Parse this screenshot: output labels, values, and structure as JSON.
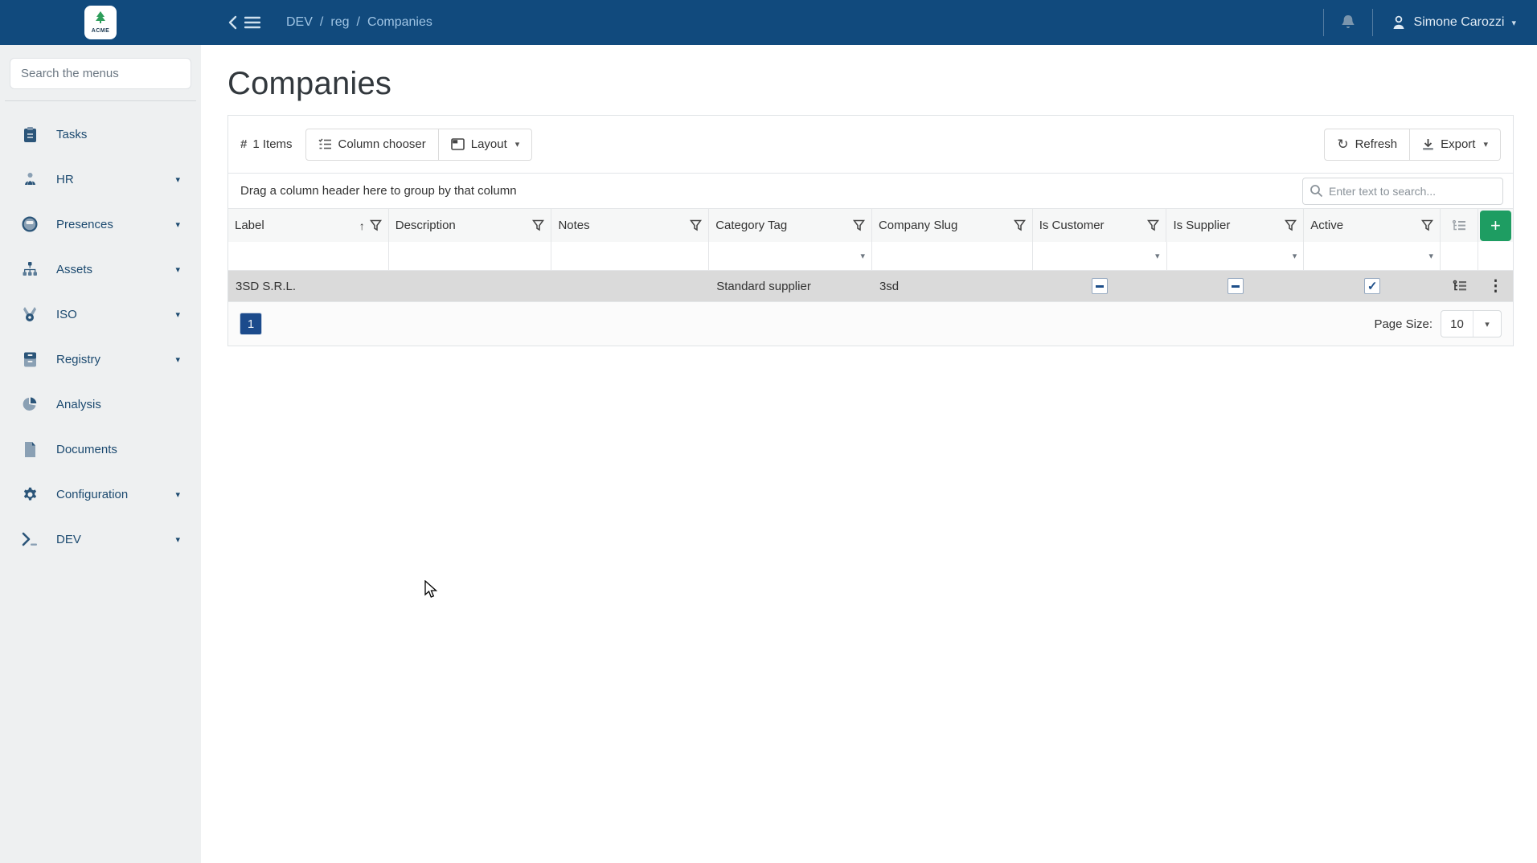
{
  "navbar": {
    "logo_text": "ACME",
    "breadcrumb": {
      "items": [
        "DEV",
        "reg",
        "Companies"
      ]
    },
    "user_name": "Simone Carozzi"
  },
  "sidebar": {
    "search_placeholder": "Search the menus",
    "items": [
      {
        "label": "Tasks"
      },
      {
        "label": "HR"
      },
      {
        "label": "Presences"
      },
      {
        "label": "Assets"
      },
      {
        "label": "ISO"
      },
      {
        "label": "Registry"
      },
      {
        "label": "Analysis"
      },
      {
        "label": "Documents"
      },
      {
        "label": "Configuration"
      },
      {
        "label": "DEV"
      }
    ]
  },
  "page": {
    "title": "Companies"
  },
  "toolbar": {
    "items_count": "1 Items",
    "column_chooser_label": "Column chooser",
    "layout_label": "Layout",
    "refresh_label": "Refresh",
    "export_label": "Export"
  },
  "grid": {
    "group_panel_text": "Drag a column header here to group by that column",
    "search_placeholder": "Enter text to search...",
    "columns": [
      {
        "label": "Label"
      },
      {
        "label": "Description"
      },
      {
        "label": "Notes"
      },
      {
        "label": "Category Tag"
      },
      {
        "label": "Company Slug"
      },
      {
        "label": "Is Customer"
      },
      {
        "label": "Is Supplier"
      },
      {
        "label": "Active"
      }
    ],
    "rows": [
      {
        "label": "3SD S.R.L.",
        "description": "",
        "notes": "",
        "category_tag": "Standard supplier",
        "company_slug": "3sd",
        "is_customer": "indeterminate",
        "is_supplier": "indeterminate",
        "active": "checked"
      }
    ],
    "pager": {
      "current_page": "1",
      "page_size_label": "Page Size:",
      "page_size": "10"
    }
  },
  "glyphs": {
    "slash": "/",
    "caret_down": "▾",
    "sort_asc": "↑",
    "plus": "+",
    "hash": "#",
    "kebab": "⋮",
    "refresh": "↻",
    "check": "✓"
  },
  "colors": {
    "navbar_blue": "#114a7d",
    "accent_blue": "#1c4b8c",
    "add_green": "#1e9d62",
    "sidebar_bg": "#eef0f1",
    "focused_row": "#dadada"
  }
}
